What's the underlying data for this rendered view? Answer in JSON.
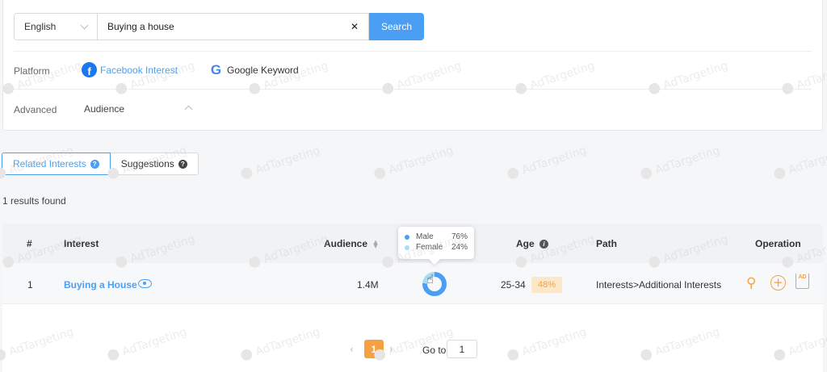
{
  "search": {
    "language": "English",
    "query": "Buying a house",
    "button_label": "Search"
  },
  "filters": {
    "platform_label": "Platform",
    "platforms": [
      "Facebook Interest",
      "Google Keyword"
    ],
    "advanced_label": "Advanced",
    "advanced_value": "Audience"
  },
  "tabs": [
    {
      "label": "Related Interests",
      "active": true
    },
    {
      "label": "Suggestions",
      "active": false
    }
  ],
  "results_text": "1 results found",
  "table": {
    "headers": {
      "index": "#",
      "interest": "Interest",
      "audience": "Audience",
      "age": "Age",
      "path": "Path",
      "operation": "Operation"
    },
    "rows": [
      {
        "index": "1",
        "interest": "Buying a House",
        "audience": "1.4M",
        "gender": {
          "male_pct": 76,
          "female_pct": 24
        },
        "age_range": "25-34",
        "age_pct": "48%",
        "path": "Interests>Additional Interests"
      }
    ]
  },
  "tooltip": {
    "male_label": "Male",
    "male_value": "76%",
    "female_label": "Female",
    "female_value": "24%"
  },
  "pagination": {
    "current_page": "1",
    "goto_label": "Go to",
    "goto_value": "1"
  },
  "watermark": "AdTargeting",
  "colors": {
    "primary": "#4a9ff5",
    "accent": "#f5a142",
    "male": "#4a9ff5",
    "female": "#a8dbf7"
  }
}
